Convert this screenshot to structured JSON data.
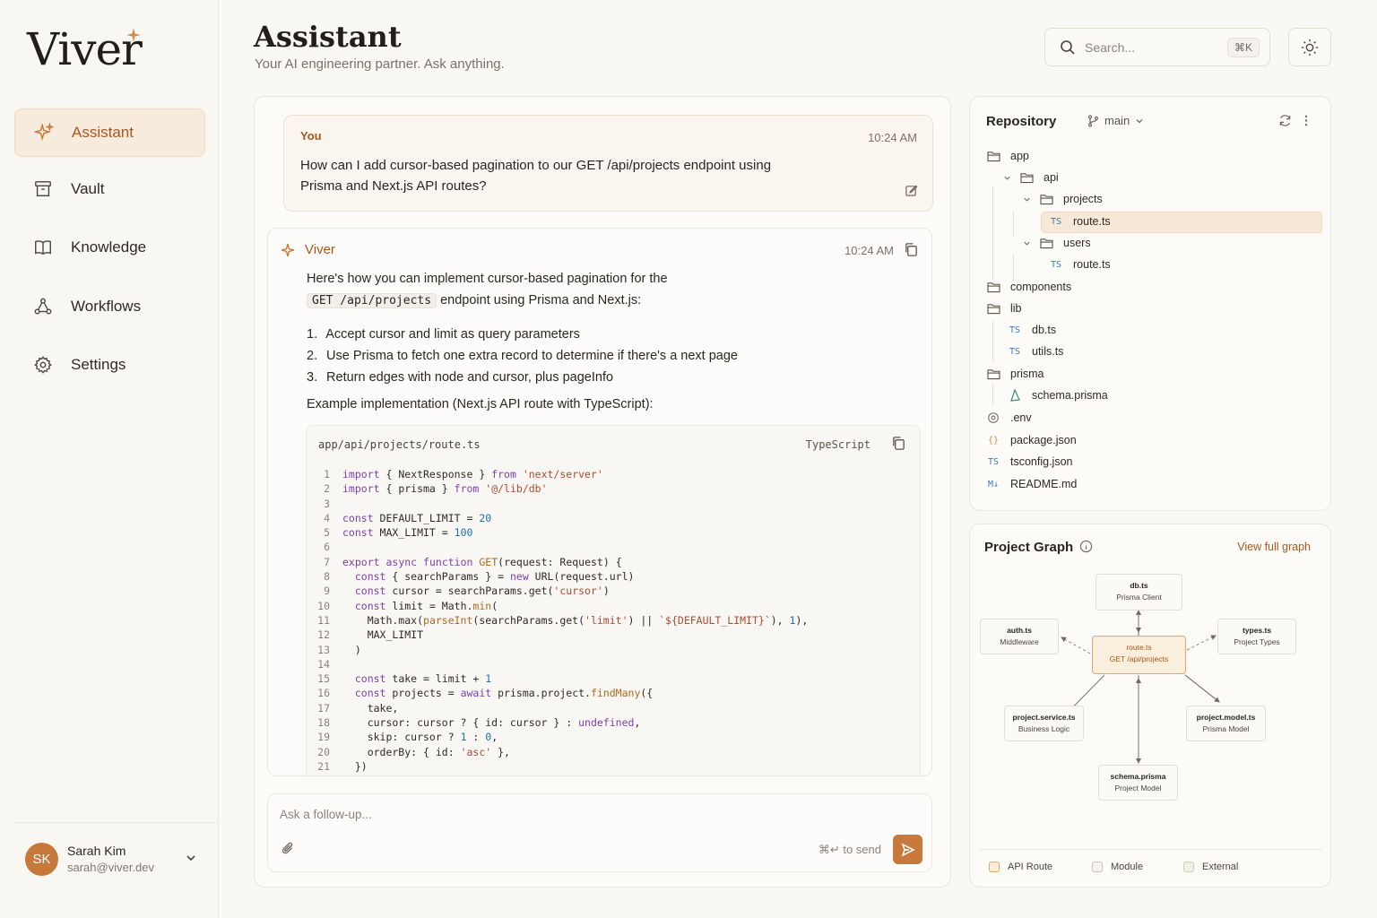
{
  "brand": {
    "name": "Viver"
  },
  "nav": [
    {
      "label": "Assistant",
      "icon": "sparkle-icon",
      "active": true
    },
    {
      "label": "Vault",
      "icon": "archive-icon"
    },
    {
      "label": "Knowledge",
      "icon": "book-icon"
    },
    {
      "label": "Workflows",
      "icon": "workflow-icon"
    },
    {
      "label": "Settings",
      "icon": "gear-icon"
    }
  ],
  "user": {
    "initials": "SK",
    "name": "Sarah Kim",
    "email": "sarah@viver.dev"
  },
  "header": {
    "title": "Assistant",
    "subtitle": "Your AI engineering partner. Ask anything.",
    "search_placeholder": "Search...",
    "search_shortcut": "⌘K"
  },
  "chat": {
    "user_message": {
      "author": "You",
      "time": "10:24 AM",
      "text": "How can I add cursor-based pagination to our GET /api/projects endpoint using Prisma and Next.js API routes?"
    },
    "ai_message": {
      "author": "Viver",
      "time": "10:24 AM",
      "intro_1": "Here's how you can implement cursor-based pagination for the",
      "intro_code": "GET /api/projects",
      "intro_2": " endpoint using Prisma and Next.js:",
      "steps": [
        {
          "num": "1.",
          "text": "Accept cursor and limit as query parameters"
        },
        {
          "num": "2.",
          "text": "Use Prisma to fetch one extra record to determine if there's a next page"
        },
        {
          "num": "3.",
          "text": "Return edges with node and cursor, plus pageInfo"
        }
      ],
      "example_label": "Example implementation (Next.js API route with TypeScript):",
      "code": {
        "filename": "app/api/projects/route.ts",
        "language": "TypeScript",
        "lines": [
          {
            "n": "1",
            "t": "import { NextResponse } from 'next/server'"
          },
          {
            "n": "2",
            "t": "import { prisma } from '@/lib/db'"
          },
          {
            "n": "3",
            "t": ""
          },
          {
            "n": "4",
            "t": "const DEFAULT_LIMIT = 20"
          },
          {
            "n": "5",
            "t": "const MAX_LIMIT = 100"
          },
          {
            "n": "6",
            "t": ""
          },
          {
            "n": "7",
            "t": "export async function GET(request: Request) {"
          },
          {
            "n": "8",
            "t": "  const { searchParams } = new URL(request.url)"
          },
          {
            "n": "9",
            "t": "  const cursor = searchParams.get('cursor')"
          },
          {
            "n": "10",
            "t": "  const limit = Math.min("
          },
          {
            "n": "11",
            "t": "    Math.max(parseInt(searchParams.get('limit') || `${DEFAULT_LIMIT}`), 1),"
          },
          {
            "n": "12",
            "t": "    MAX_LIMIT"
          },
          {
            "n": "13",
            "t": "  )"
          },
          {
            "n": "14",
            "t": ""
          },
          {
            "n": "15",
            "t": "  const take = limit + 1"
          },
          {
            "n": "16",
            "t": "  const projects = await prisma.project.findMany({"
          },
          {
            "n": "17",
            "t": "    take,"
          },
          {
            "n": "18",
            "t": "    cursor: cursor ? { id: cursor } : undefined,"
          },
          {
            "n": "19",
            "t": "    skip: cursor ? 1 : 0,"
          },
          {
            "n": "20",
            "t": "    orderBy: { id: 'asc' },"
          },
          {
            "n": "21",
            "t": "  })"
          }
        ]
      }
    },
    "composer": {
      "placeholder": "Ask a follow-up...",
      "send_hint": "⌘↵ to send"
    }
  },
  "repository": {
    "title": "Repository",
    "branch": "main",
    "tree": [
      {
        "name": "app",
        "icon": "folder-icon"
      },
      {
        "name": "api",
        "icon": "folder-icon"
      },
      {
        "name": "projects",
        "icon": "folder-icon"
      },
      {
        "name": "route.ts",
        "icon": "ts-file-icon",
        "badge": "TS",
        "selected": true
      },
      {
        "name": "users",
        "icon": "folder-icon"
      },
      {
        "name": "route.ts",
        "icon": "ts-file-icon",
        "badge": "TS"
      },
      {
        "name": "components",
        "icon": "folder-icon"
      },
      {
        "name": "lib",
        "icon": "folder-icon"
      },
      {
        "name": "db.ts",
        "icon": "ts-file-icon",
        "badge": "TS"
      },
      {
        "name": "utils.ts",
        "icon": "ts-file-icon",
        "badge": "TS"
      },
      {
        "name": "prisma",
        "icon": "folder-icon"
      },
      {
        "name": "schema.prisma",
        "icon": "prisma-icon"
      },
      {
        "name": ".env",
        "icon": "settings-file-icon"
      },
      {
        "name": "package.json",
        "icon": "json-icon",
        "badge": "{}"
      },
      {
        "name": "tsconfig.json",
        "icon": "ts-file-icon",
        "badge": "TS"
      },
      {
        "name": "README.md",
        "icon": "markdown-icon",
        "badge": "M↓"
      }
    ]
  },
  "project_graph": {
    "title": "Project Graph",
    "link": "View full graph",
    "nodes": [
      {
        "name": "db.ts",
        "desc": "Prisma Client"
      },
      {
        "name": "auth.ts",
        "desc": "Middleware"
      },
      {
        "name": "route.ts",
        "desc": "GET /api/projects"
      },
      {
        "name": "types.ts",
        "desc": "Project Types"
      },
      {
        "name": "project.service.ts",
        "desc": "Business Logic"
      },
      {
        "name": "project.model.ts",
        "desc": "Prisma Model"
      },
      {
        "name": "schema.prisma",
        "desc": "Project Model"
      }
    ],
    "legend": [
      {
        "label": "API Route",
        "color": "#faeedd",
        "border": "#e2a56a"
      },
      {
        "label": "Module",
        "color": "#f4f2ef",
        "border": "#c9c4bd"
      },
      {
        "label": "External",
        "color": "#eef2e6",
        "border": "#c8d1b8"
      }
    ]
  }
}
